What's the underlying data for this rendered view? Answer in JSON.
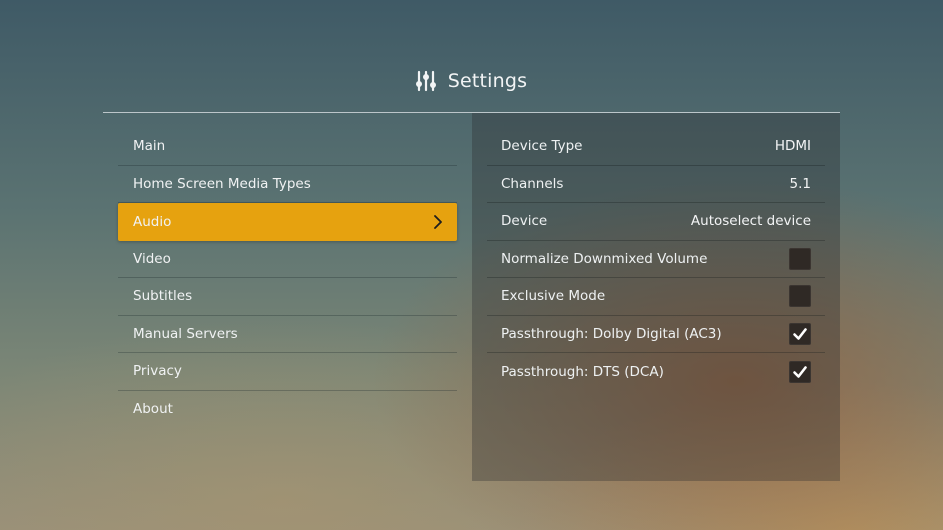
{
  "header": {
    "title": "Settings",
    "icon": "sliders-icon"
  },
  "menu": {
    "items": [
      {
        "label": "Main"
      },
      {
        "label": "Home Screen Media Types"
      },
      {
        "label": "Audio",
        "active": true
      },
      {
        "label": "Video"
      },
      {
        "label": "Subtitles"
      },
      {
        "label": "Manual Servers"
      },
      {
        "label": "Privacy"
      },
      {
        "label": "About"
      }
    ]
  },
  "audio_settings": {
    "rows": [
      {
        "label": "Device Type",
        "value": "HDMI"
      },
      {
        "label": "Channels",
        "value": "5.1"
      },
      {
        "label": "Device",
        "value": "Autoselect device"
      },
      {
        "label": "Normalize Downmixed Volume",
        "checked": false
      },
      {
        "label": "Exclusive Mode",
        "checked": false
      },
      {
        "label": "Passthrough: Dolby Digital (AC3)",
        "checked": true
      },
      {
        "label": "Passthrough: DTS (DCA)",
        "checked": true
      }
    ]
  },
  "colors": {
    "accent": "#e6a20f",
    "checkbox_bg": "#2f2925"
  }
}
